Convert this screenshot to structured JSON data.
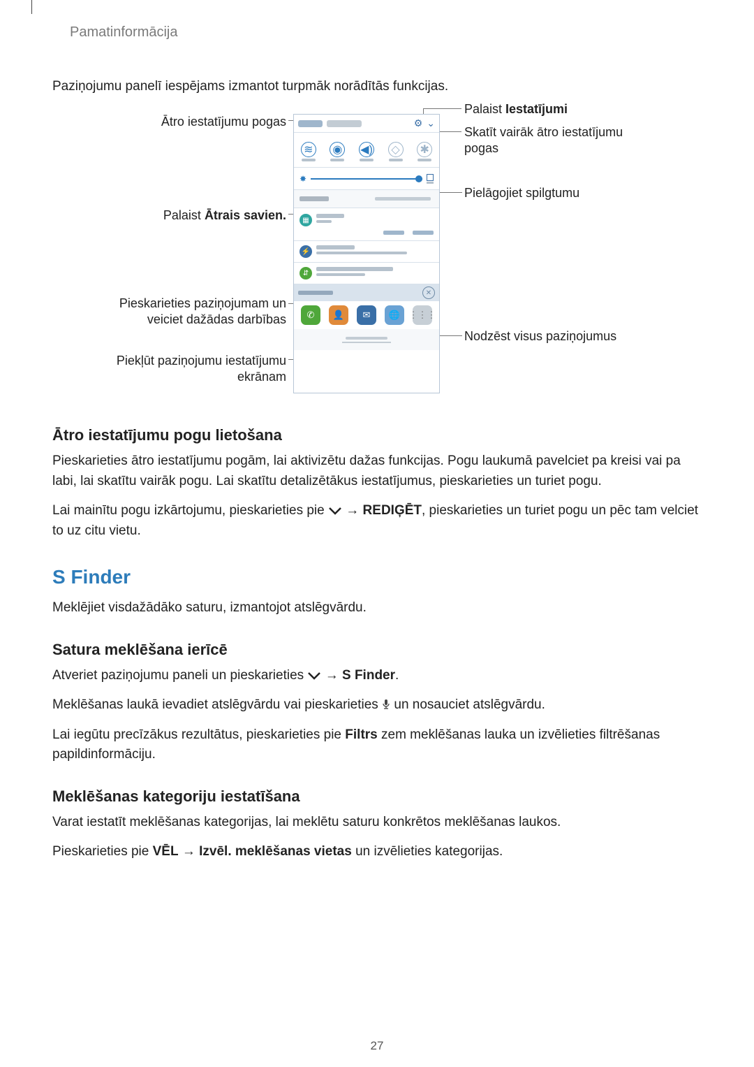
{
  "breadcrumb": "Pamatinformācija",
  "intro": "Paziņojumu panelī iespējams izmantot turpmāk norādītās funkcijas.",
  "callouts": {
    "left1": "Ātro iestatījumu pogas",
    "left2_a": "Palaist ",
    "left2_b": "Ātrais savien.",
    "left3": "Pieskarieties paziņojumam un veiciet dažādas darbības",
    "left4": "Piekļūt paziņojumu iestatījumu ekrānam",
    "right1_a": "Palaist ",
    "right1_b": "Iestatījumi",
    "right2": "Skatīt vairāk ātro iestatījumu pogas",
    "right3": "Pielāgojiet spilgtumu",
    "right4": "Nodzēst visus paziņojumus"
  },
  "section1": {
    "heading": "Ātro iestatījumu pogu lietošana",
    "p1": "Pieskarieties ātro iestatījumu pogām, lai aktivizētu dažas funkcijas. Pogu laukumā pavelciet pa kreisi vai pa labi, lai skatītu vairāk pogu. Lai skatītu detalizētākus iestatījumus, pieskarieties un turiet pogu.",
    "p2a": "Lai mainītu pogu izkārtojumu, pieskarieties pie ",
    "p2arrow": " → ",
    "p2b": "REDIĢĒT",
    "p2c": ", pieskarieties un turiet pogu un pēc tam velciet to uz citu vietu."
  },
  "section2": {
    "heading": "S Finder",
    "p1": "Meklējiet visdažādāko saturu, izmantojot atslēgvārdu."
  },
  "section3": {
    "heading": "Satura meklēšana ierīcē",
    "p1a": "Atveriet paziņojumu paneli un pieskarieties ",
    "p1arrow": " → ",
    "p1b": "S Finder",
    "p1c": ".",
    "p2a": "Meklēšanas laukā ievadiet atslēgvārdu vai pieskarieties ",
    "p2b": " un nosauciet atslēgvārdu.",
    "p3a": "Lai iegūtu precīzākus rezultātus, pieskarieties pie ",
    "p3b": "Filtrs",
    "p3c": " zem meklēšanas lauka un izvēlieties filtrēšanas papildinformāciju."
  },
  "section4": {
    "heading": "Meklēšanas kategoriju iestatīšana",
    "p1": "Varat iestatīt meklēšanas kategorijas, lai meklētu saturu konkrētos meklēšanas laukos.",
    "p2a": "Pieskarieties pie ",
    "p2b": "VĒL",
    "p2arrow": " → ",
    "p2c": "Izvēl. meklēšanas vietas",
    "p2d": " un izvēlieties kategorijas."
  },
  "pagenum": "27"
}
